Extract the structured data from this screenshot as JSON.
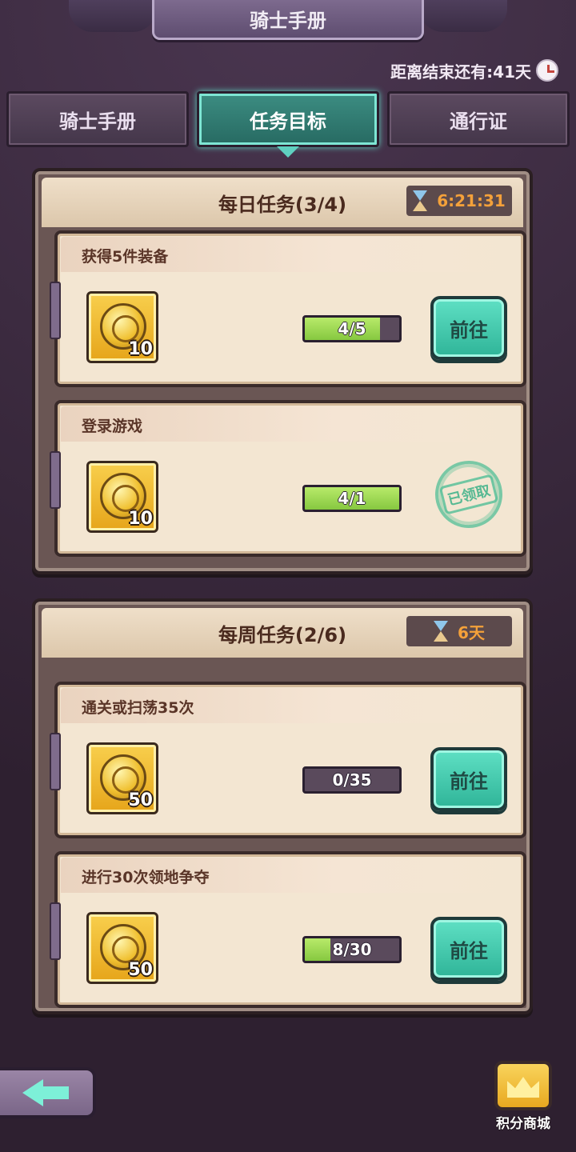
{
  "header": {
    "title": "骑士手册"
  },
  "countdown": {
    "text": "距离结束还有:41天"
  },
  "tabs": [
    {
      "label": "骑士手册",
      "active": false
    },
    {
      "label": "任务目标",
      "active": true
    },
    {
      "label": "通行证",
      "active": false
    }
  ],
  "daily": {
    "title": "每日任务(3/4)",
    "timer": "6:21:31",
    "tasks": [
      {
        "title": "获得5件装备",
        "reward_qty": "10",
        "progress_text": "4/5",
        "progress": 0.8,
        "action": "前往"
      },
      {
        "title": "登录游戏",
        "reward_qty": "10",
        "progress_text": "4/1",
        "progress": 1.0,
        "status": "已领取"
      }
    ]
  },
  "weekly": {
    "title": "每周任务(2/6)",
    "timer": "6天",
    "tasks": [
      {
        "title": "通关或扫荡35次",
        "reward_qty": "50",
        "progress_text": "0/35",
        "progress": 0.0,
        "action": "前往"
      },
      {
        "title": "进行30次领地争夺",
        "reward_qty": "50",
        "progress_text": "8/30",
        "progress": 0.267,
        "action": "前往"
      }
    ]
  },
  "shop": {
    "label": "积分商城"
  },
  "colors": {
    "accent": "#5fe0c4",
    "timer": "#f4a13a",
    "progress": "#9ad850"
  }
}
